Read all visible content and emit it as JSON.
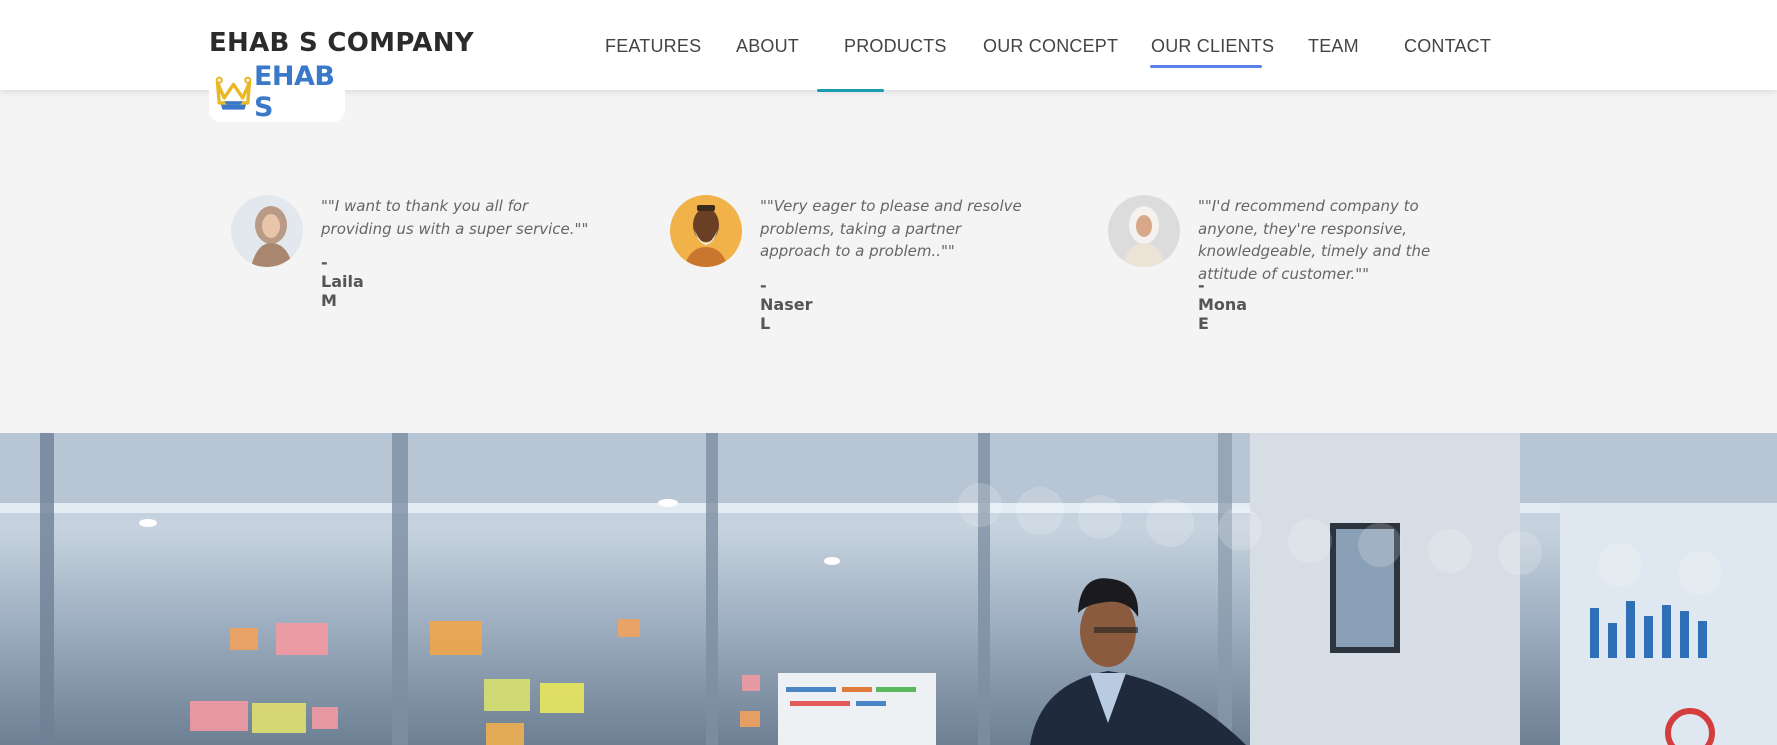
{
  "header": {
    "brand": "EHAB S COMPANY",
    "logo_text": "EHAB S"
  },
  "nav": {
    "items": [
      {
        "label": "FEATURES"
      },
      {
        "label": "ABOUT"
      },
      {
        "label": "PRODUCTS"
      },
      {
        "label": "OUR CONCEPT"
      },
      {
        "label": "OUR CLIENTS"
      },
      {
        "label": "TEAM"
      },
      {
        "label": "CONTACT"
      }
    ],
    "active": "OUR CLIENTS"
  },
  "testimonials": [
    {
      "quote": "\"\"I want to thank you all for providing us with a super service.\"\"",
      "author": "- Laila M"
    },
    {
      "quote": "\"\"Very eager to please and resolve problems, taking a partner approach to a problem..\"\"",
      "author": "- Naser L"
    },
    {
      "quote": "\"\"I'd recommend company to anyone, they're responsive, knowledgeable, timely and the attitude of customer.\"\"",
      "author": "- Mona E"
    }
  ],
  "colors": {
    "accent_blue": "#5b7fe8",
    "accent_teal": "#1a9bb0",
    "logo_blue": "#3a78c9",
    "logo_gold": "#e8b923"
  }
}
